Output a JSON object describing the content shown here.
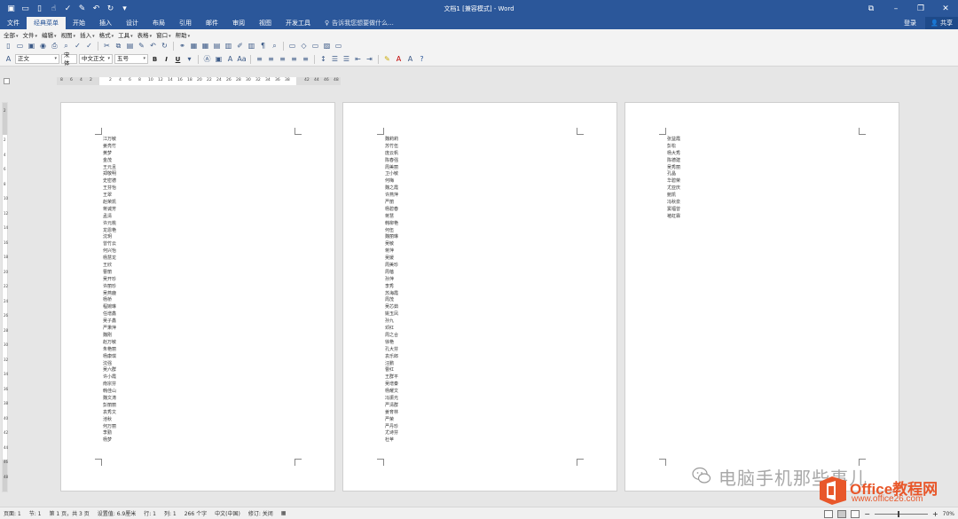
{
  "titlebar": {
    "title": "文档1 [兼容模式] - Word",
    "qat_icons": [
      "save-icon",
      "open-icon",
      "new-icon",
      "touch-mode-icon",
      "spelling-icon",
      "format-painter-icon",
      "undo-icon",
      "redo-icon",
      "customize-qat-icon"
    ],
    "window_buttons": [
      "ribbon-display-icon",
      "minimize-icon",
      "restore-icon",
      "close-icon"
    ]
  },
  "ribbon": {
    "tabs": [
      "文件",
      "经典菜单",
      "开始",
      "插入",
      "设计",
      "布局",
      "引用",
      "邮件",
      "审阅",
      "视图",
      "开发工具"
    ],
    "active_tab": "经典菜单",
    "tell_me": "告诉我您想要做什么...",
    "sign_in": "登录",
    "share": "共享"
  },
  "classic_menu": {
    "items": [
      "全部",
      "文件",
      "编辑",
      "视图",
      "插入",
      "格式",
      "工具",
      "表格",
      "窗口",
      "帮助"
    ]
  },
  "toolbar": {
    "style": "正文",
    "font": "宋体",
    "font_ea": "中文正文",
    "size": "五号",
    "bold": "B",
    "italic": "I",
    "underline": "U"
  },
  "ruler": {
    "ticks": [
      "8",
      "6",
      "4",
      "2",
      "",
      "2",
      "4",
      "6",
      "8",
      "10",
      "12",
      "14",
      "16",
      "18",
      "20",
      "22",
      "24",
      "26",
      "28",
      "30",
      "32",
      "34",
      "36",
      "38",
      "",
      "42",
      "44",
      "46",
      "48"
    ],
    "vticks": [
      "2",
      "",
      "2",
      "4",
      "6",
      "8",
      "10",
      "12",
      "14",
      "16",
      "18",
      "20",
      "22",
      "24",
      "26",
      "28",
      "30",
      "32",
      "34",
      "36",
      "38",
      "40",
      "42",
      "44",
      "46",
      "48"
    ]
  },
  "pages": [
    {
      "lines": [
        "江万敏",
        "姜亮竹",
        "黄梦",
        "金茂",
        "王元且",
        "郑敬明",
        "史密德",
        "王芬怡",
        "王翠",
        "赵荣凯",
        "蒋诚芳",
        "孟清",
        "许元桃",
        "龙恩艳",
        "沈玥",
        "曾竹云",
        "何兴怡",
        "杨慧龙",
        "王欣",
        "曹丽",
        "吴开珍",
        "许丽珍",
        "吴燕鹿",
        "杨桥",
        "程婉琳",
        "任增鑫",
        "吴子鑫",
        "严秉萍",
        "魏刚",
        "赵万敏",
        "朱艳丽",
        "杨康琪",
        "沈强",
        "吴六群",
        "许小霞",
        "南宗芬",
        "韩佳山",
        "魏文涛",
        "彭丽丽",
        "袁秀文",
        "池秋",
        "何万丽",
        "李勤",
        "杨梦"
      ]
    },
    {
      "lines": [
        "魏莉莉",
        "苏竹伍",
        "庞云帆",
        "陈春强",
        "周美丽",
        "卫小敏",
        "何梅",
        "魏之霞",
        "许燕萍",
        "严丽",
        "杨碧春",
        "蒋慧",
        "韩柳艳",
        "何伍",
        "魏丽琳",
        "吴敏",
        "蒋萍",
        "吴媛",
        "周美珍",
        "周蓓",
        "孙萍",
        "李秀",
        "苏海霞",
        "周茂",
        "吴芯茹",
        "姚玉凤",
        "孙九",
        "邓红",
        "周之合",
        "徐艳",
        "孔大芬",
        "袁乐郎",
        "汪鹏",
        "曹红",
        "王群平",
        "吴增秦",
        "杨耀文",
        "冯振光",
        "严清群",
        "姜育林",
        "严荣",
        "严丹珍",
        "尤诗芬",
        "杜苹"
      ]
    },
    {
      "lines": [
        "张益霞",
        "彭松",
        "杨大秀",
        "陈德建",
        "吴秀丽",
        "孔晶",
        "华碧荣",
        "尤亚庆",
        "鲍凯",
        "冯秋泉",
        "窦福曾",
        "褚虹霖"
      ]
    }
  ],
  "watermark": {
    "channel": "电脑手机那些事儿",
    "brand": "Office教程网",
    "url": "www.office26.com"
  },
  "statusbar": {
    "items": [
      "页面: 1",
      "节: 1",
      "第 1 页，共 3 页",
      "设置值: 6.9厘米",
      "行: 1",
      "列: 1",
      "266 个字",
      "中文(中国)",
      "修订: 关闭"
    ],
    "zoom": "70%",
    "zoom_fraction": 0.43
  },
  "colors": {
    "accent": "#2b579a",
    "brand": "#e8572a"
  }
}
